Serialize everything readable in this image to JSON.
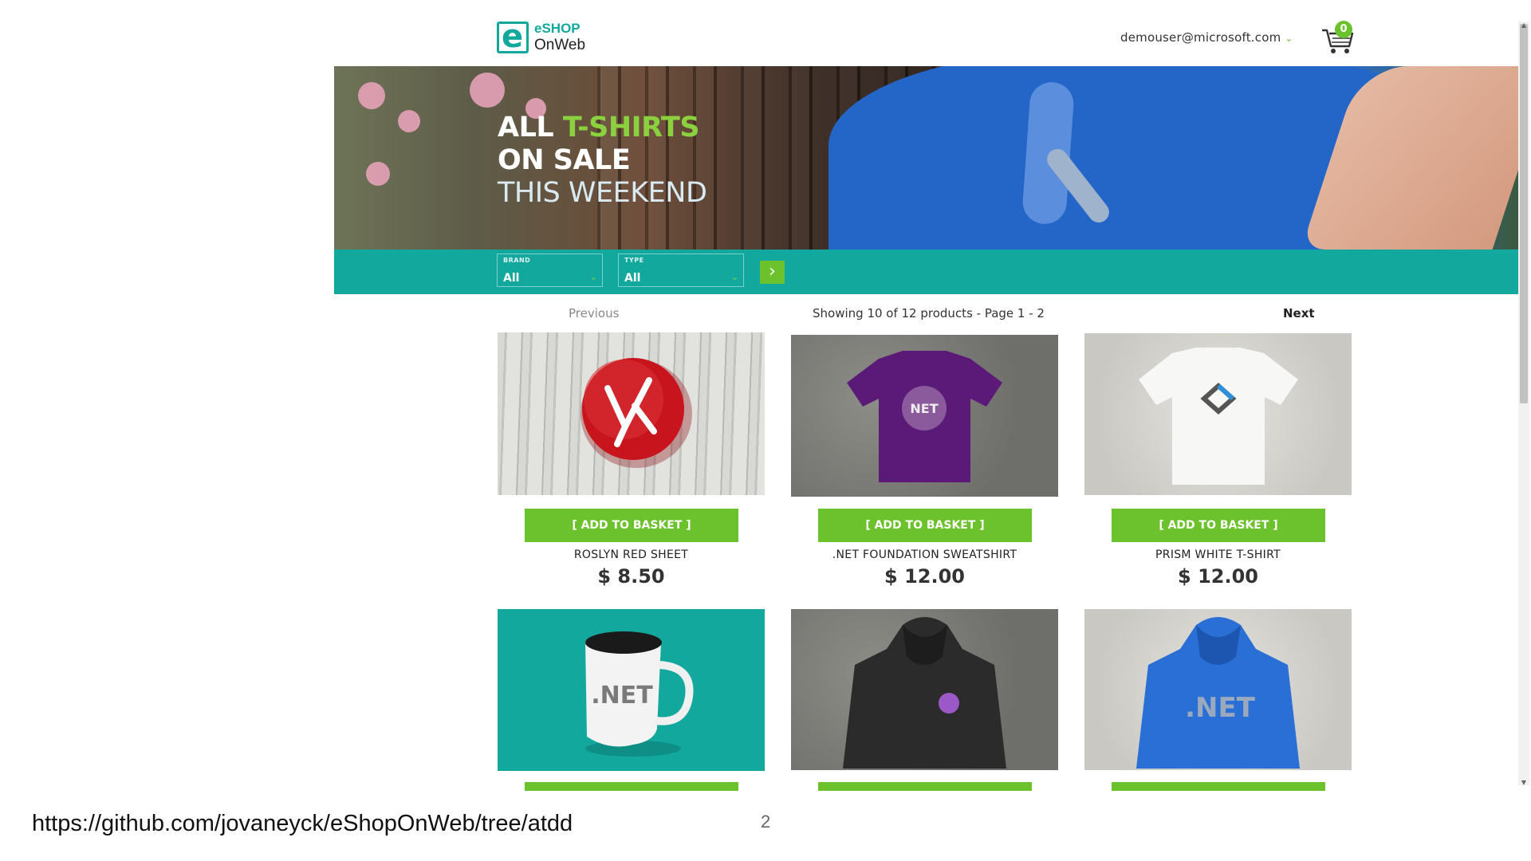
{
  "header": {
    "logo_line1": "eSHOP",
    "logo_line2": "OnWeb",
    "logo_mark": "e",
    "user_email": "demouser@microsoft.com",
    "cart_count": "0"
  },
  "hero": {
    "line1_a": "ALL",
    "line1_b": "T-SHIRTS",
    "line2": "ON SALE",
    "line3": "THIS WEEKEND"
  },
  "filters": {
    "brand_label": "BRAND",
    "brand_value": "All",
    "type_label": "TYPE",
    "type_value": "All",
    "submit_icon": "chevron-right-icon"
  },
  "pagination": {
    "previous": "Previous",
    "info": "Showing 10 of 12 products - Page 1 - 2",
    "next": "Next"
  },
  "products": [
    {
      "name": "ROSLYN RED SHEET",
      "price": "$ 8.50",
      "button": "[ ADD TO BASKET ]",
      "image": "red-badge"
    },
    {
      "name": ".NET FOUNDATION SWEATSHIRT",
      "price": "$ 12.00",
      "button": "[ ADD TO BASKET ]",
      "image": "purple-tshirt"
    },
    {
      "name": "PRISM WHITE T-SHIRT",
      "price": "$ 12.00",
      "button": "[ ADD TO BASKET ]",
      "image": "white-tshirt"
    },
    {
      "image": "net-mug"
    },
    {
      "image": "black-hoodie"
    },
    {
      "image": "blue-hoodie"
    }
  ],
  "footer": {
    "url": "https://github.com/jovaneyck/eShopOnWeb/tree/atdd",
    "page_number": "2"
  },
  "colors": {
    "accent_teal": "#13a89e",
    "accent_green": "#6cc22c"
  }
}
